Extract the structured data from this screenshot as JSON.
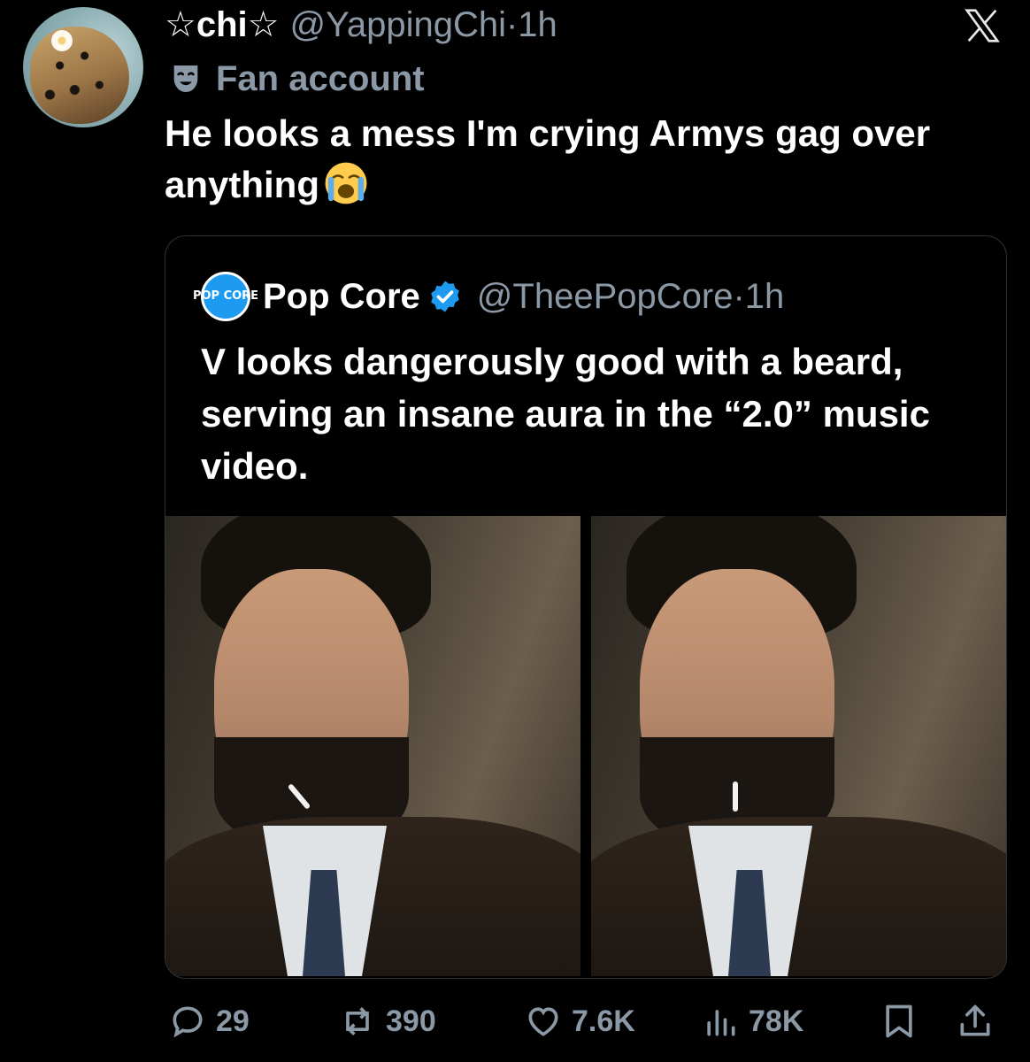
{
  "author": {
    "display_name": "☆chi☆",
    "handle": "@YappingChi",
    "time": "·1h",
    "label": "Fan account"
  },
  "tweet": {
    "text": "He looks a mess I'm crying Armys gag over anything"
  },
  "quoted": {
    "avatar_text": "POP CORE",
    "display_name": "Pop Core",
    "handle": "@TheePopCore",
    "time": "·1h",
    "text": "V looks dangerously good with a beard, serving an insane aura in the “2.0” music video."
  },
  "actions": {
    "replies": "29",
    "reposts": "390",
    "likes": "7.6K",
    "views": "78K"
  },
  "icons": {
    "platform": "x-logo-icon",
    "label": "theater-mask-icon",
    "emoji": "loudly-crying-face-emoji",
    "verified": "verified-badge-icon",
    "reply": "reply-icon",
    "repost": "repost-icon",
    "like": "heart-icon",
    "views": "views-icon",
    "bookmark": "bookmark-icon",
    "share": "share-icon"
  },
  "colors": {
    "background": "#000000",
    "text": "#ffffff",
    "muted": "#8b98a5",
    "verified": "#1d9bf0"
  }
}
